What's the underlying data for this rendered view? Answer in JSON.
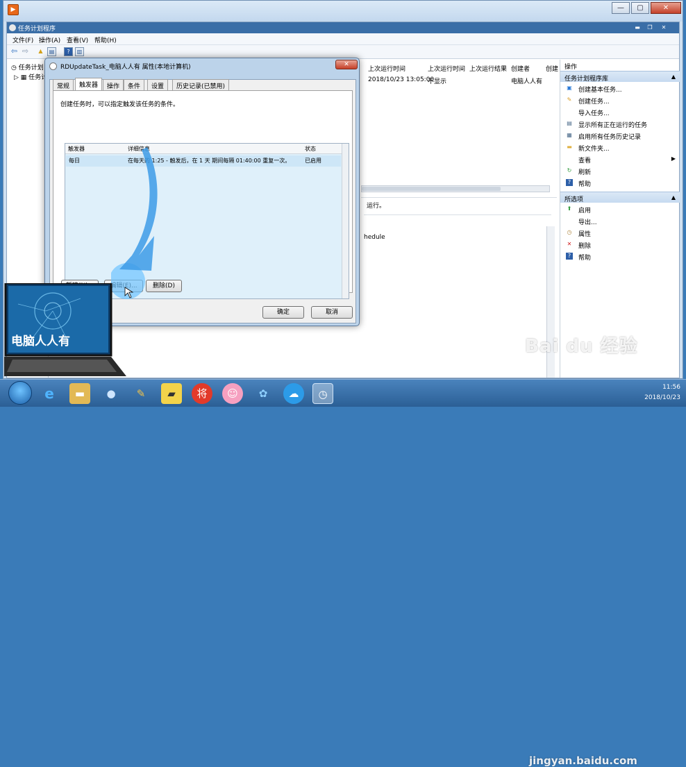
{
  "app": {
    "window_title": "任务计划程序",
    "min_glyph": "—",
    "max_glyph": "▢",
    "close_glyph": "✕"
  },
  "menu": [
    "文件(F)",
    "操作(A)",
    "查看(V)",
    "帮助(H)"
  ],
  "tree": [
    "任务计划",
    "任务计"
  ],
  "task_list": {
    "headers": [
      "上次运行时间",
      "上次运行时间",
      "上次运行结果",
      "创建者",
      "创建"
    ],
    "row": [
      "2018/10/23 13:05:00",
      "不显示",
      "",
      "电脑人人有",
      ""
    ],
    "fragment1": "运行。",
    "fragment2": "hedule"
  },
  "actions": {
    "header": "操作",
    "section1_title": "任务计划程序库",
    "section1_items": [
      {
        "icon": "create-basic-task-icon",
        "label": "创建基本任务..."
      },
      {
        "icon": "create-task-icon",
        "label": "创建任务..."
      },
      {
        "icon": "",
        "label": "导入任务..."
      },
      {
        "icon": "running-tasks-icon",
        "label": "显示所有正在运行的任务"
      },
      {
        "icon": "history-icon",
        "label": "启用所有任务历史记录"
      },
      {
        "icon": "folder-icon",
        "label": "新文件夹..."
      },
      {
        "icon": "",
        "label": "查看"
      },
      {
        "icon": "refresh-icon",
        "label": "刷新"
      },
      {
        "icon": "help-icon",
        "label": "帮助"
      }
    ],
    "section2_title": "所选项",
    "section2_items": [
      {
        "icon": "enable-icon",
        "label": "启用"
      },
      {
        "icon": "",
        "label": "导出..."
      },
      {
        "icon": "properties-icon",
        "label": "属性"
      },
      {
        "icon": "delete-icon",
        "label": "删除"
      },
      {
        "icon": "help-icon",
        "label": "帮助"
      }
    ]
  },
  "dialog": {
    "title": "RDUpdateTask_电脑人人有 属性(本地计算机)",
    "tabs": [
      "常规",
      "触发器",
      "操作",
      "条件",
      "设置",
      "历史记录(已禁用)"
    ],
    "active_tab": 1,
    "tip": "创建任务时，可以指定触发该任务的条件。",
    "columns": [
      "触发器",
      "详细信息",
      "状态"
    ],
    "rows": [
      {
        "trigger": "每日",
        "detail": "在每天的 1:25 - 触发后，在 1 天 期间每隔 01:40:00 重复一次。",
        "status": "已启用"
      }
    ],
    "buttons": {
      "new": "新建(N)...",
      "edit": "编辑(E)...",
      "delete": "删除(D)",
      "ok": "确定",
      "cancel": "取消"
    }
  },
  "logo": {
    "text": "电脑人人有"
  },
  "taskbar": {
    "time": "11:56",
    "date": "2018/10/23"
  },
  "watermark": {
    "main": "Bai du 经验",
    "sub": "jingyan.baidu.com"
  },
  "colors": {
    "accent": "#3a6ea7",
    "selection": "#cde6f7",
    "arrow": "#3d9be6"
  }
}
